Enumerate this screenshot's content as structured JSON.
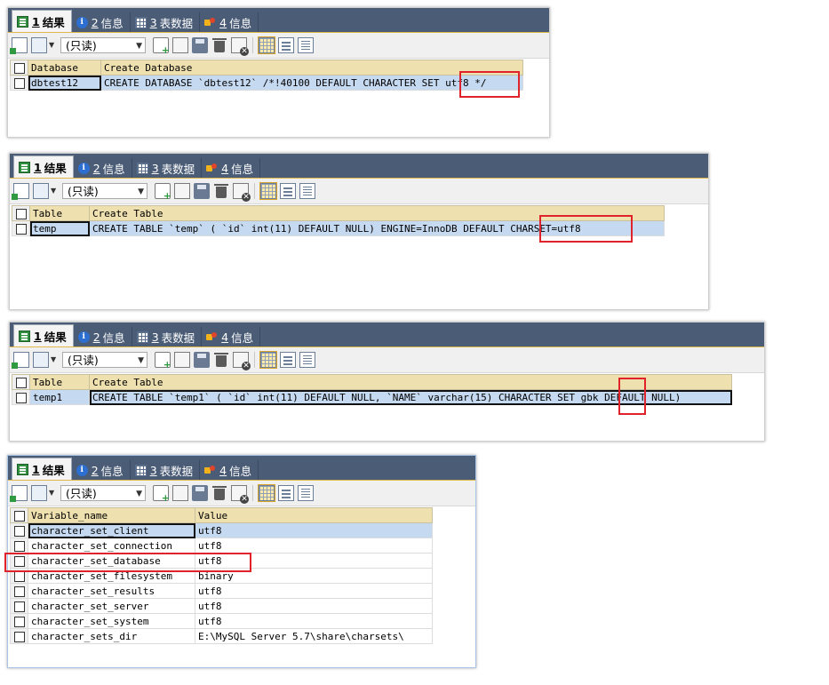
{
  "tabs": [
    {
      "num": "1",
      "label": "结果",
      "icon": "result-grid-icon"
    },
    {
      "num": "2",
      "label": "信息",
      "icon": "info-icon"
    },
    {
      "num": "3",
      "label": "表数据",
      "icon": "table-data-icon"
    },
    {
      "num": "4",
      "label": "信息",
      "icon": "messages-icon"
    }
  ],
  "toolbar": {
    "readonly_option": "(只读)"
  },
  "panel1": {
    "headers": [
      "Database",
      "Create Database"
    ],
    "rows": [
      [
        "dbtest12",
        "CREATE DATABASE `dbtest12` /*!40100 DEFAULT CHARACTER SET utf8 */"
      ]
    ]
  },
  "panel2": {
    "headers": [
      "Table",
      "Create Table"
    ],
    "rows": [
      [
        "temp",
        "CREATE TABLE `temp` (  `id` int(11) DEFAULT NULL) ENGINE=InnoDB DEFAULT CHARSET=utf8"
      ]
    ]
  },
  "panel3": {
    "headers": [
      "Table",
      "Create Table"
    ],
    "rows": [
      [
        "temp1",
        "CREATE TABLE `temp1` (  `id` int(11) DEFAULT NULL,  `NAME` varchar(15) CHARACTER SET gbk DEFAULT NULL)"
      ]
    ]
  },
  "panel4": {
    "headers": [
      "Variable_name",
      "Value"
    ],
    "rows": [
      [
        "character_set_client",
        "utf8"
      ],
      [
        "character_set_connection",
        "utf8"
      ],
      [
        "character_set_database",
        "utf8"
      ],
      [
        "character_set_filesystem",
        "binary"
      ],
      [
        "character_set_results",
        "utf8"
      ],
      [
        "character_set_server",
        "utf8"
      ],
      [
        "character_set_system",
        "utf8"
      ],
      [
        "character_sets_dir",
        "E:\\MySQL Server 5.7\\share\\charsets\\"
      ]
    ]
  },
  "colors": {
    "tabbar_bg": "#4a5c76",
    "header_bg": "#efe0b0",
    "selected_row": "#c5d9f0",
    "highlight_box": "#e0222a"
  }
}
